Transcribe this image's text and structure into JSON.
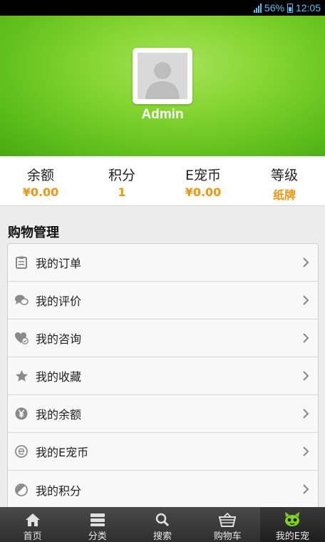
{
  "status_bar": {
    "battery": "56%",
    "time": "12:05"
  },
  "profile": {
    "username": "Admin"
  },
  "stats": [
    {
      "label": "余额",
      "value": "¥0.00"
    },
    {
      "label": "积分",
      "value": "1"
    },
    {
      "label": "E宠币",
      "value": "¥0.00"
    },
    {
      "label": "等级",
      "value": "纸牌"
    }
  ],
  "section": {
    "title": "购物管理"
  },
  "menu": [
    {
      "label": "我的订单",
      "icon": "clipboard-icon"
    },
    {
      "label": "我的评价",
      "icon": "chat-bubbles-icon"
    },
    {
      "label": "我的咨询",
      "icon": "heart-check-icon"
    },
    {
      "label": "我的收藏",
      "icon": "star-icon"
    },
    {
      "label": "我的余额",
      "icon": "yen-coin-icon"
    },
    {
      "label": "我的E宠币",
      "icon": "e-coin-icon"
    },
    {
      "label": "我的积分",
      "icon": "points-icon"
    }
  ],
  "tabs": [
    {
      "label": "首页",
      "icon": "home-icon"
    },
    {
      "label": "分类",
      "icon": "category-icon"
    },
    {
      "label": "搜索",
      "icon": "search-icon"
    },
    {
      "label": "购物车",
      "icon": "cart-icon"
    },
    {
      "label": "我的E宠",
      "icon": "pet-face-icon"
    }
  ],
  "colors": {
    "accent": "#f39410",
    "header_green": "#86d532",
    "active_tab_icon": "#7ed321"
  }
}
